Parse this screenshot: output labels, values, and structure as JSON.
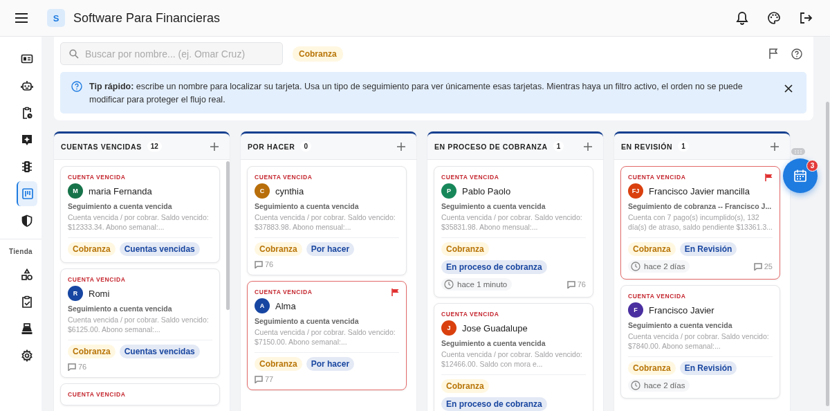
{
  "header": {
    "title": "Software Para Financieras",
    "logo_letter": "S"
  },
  "sidebar": {
    "items": [
      {
        "selected": false
      },
      {
        "selected": false
      },
      {
        "selected": false
      },
      {
        "selected": false
      },
      {
        "selected": false
      },
      {
        "selected": true
      },
      {
        "selected": false
      }
    ],
    "section_label": "Tienda",
    "store_items": [
      {
        "selected": false
      },
      {
        "selected": false
      },
      {
        "selected": false
      },
      {
        "selected": false
      }
    ]
  },
  "toolbar": {
    "search": {
      "placeholder": "Buscar por nombre... (ej. Omar Cruz)"
    },
    "filter_chip": "Cobranza"
  },
  "tip": {
    "text": "**Tip rápido:** escribe un nombre para localizar su tarjeta. Usa un tipo de seguimiento para ver únicamente esas tarjetas. Mientras haya un filtro activo, el orden no se puede modificar para proteger el flujo real."
  },
  "columns": [
    {
      "title": "CUENTAS VENCIDAS",
      "count": "12",
      "cards": [
        {
          "label": "CUENTA VENCIDA",
          "flagged": false,
          "initials": "M",
          "color": "#17734a",
          "name": "maria Fernanda",
          "subtitle": "Seguimiento a cuenta vencida",
          "description": "Cuenta vencida / por cobrar. Saldo vencido: $12333.34. Abono semanal:...",
          "tags": [
            {
              "kind": "type",
              "text": "Cobranza"
            },
            {
              "kind": "status",
              "text": "Cuentas vencidas"
            }
          ]
        },
        {
          "label": "CUENTA VENCIDA",
          "flagged": false,
          "initials": "R",
          "color": "#1746a2",
          "name": "Romi",
          "subtitle": "Seguimiento a cuenta vencida",
          "description": "Cuenta vencida / por cobrar. Saldo vencido: $6125.00. Abono semanal:...",
          "tags": [
            {
              "kind": "type",
              "text": "Cobranza"
            },
            {
              "kind": "status",
              "text": "Cuentas vencidas"
            }
          ],
          "comments": "76"
        },
        {
          "label": "CUENTA VENCIDA",
          "flagged": false
        }
      ]
    },
    {
      "title": "POR HACER",
      "count": "0",
      "cards": [
        {
          "label": "CUENTA VENCIDA",
          "flagged": false,
          "initials": "C",
          "color": "#b86e0a",
          "name": "cynthia",
          "subtitle": "Seguimiento a cuenta vencida",
          "description": "Cuenta vencida / por cobrar. Saldo vencido: $37883.98. Abono mensual:...",
          "tags": [
            {
              "kind": "type",
              "text": "Cobranza"
            },
            {
              "kind": "status",
              "text": "Por hacer"
            }
          ],
          "comments": "76"
        },
        {
          "label": "CUENTA VENCIDA",
          "flagged": true,
          "initials": "A",
          "color": "#1746a2",
          "name": "Alma",
          "subtitle": "Seguimiento a cuenta vencida",
          "description": "Cuenta vencida / por cobrar. Saldo vencido: $7150.00. Abono semanal:...",
          "tags": [
            {
              "kind": "type",
              "text": "Cobranza"
            },
            {
              "kind": "status",
              "text": "Por hacer"
            }
          ],
          "comments": "77"
        }
      ]
    },
    {
      "title": "EN PROCESO DE COBRANZA",
      "count": "1",
      "cards": [
        {
          "label": "CUENTA VENCIDA",
          "flagged": false,
          "initials": "P",
          "color": "#17875a",
          "name": "Pablo Paolo",
          "subtitle": "Seguimiento a cuenta vencida",
          "description": "Cuenta vencida / por cobrar. Saldo vencido: $35831.98. Abono mensual:...",
          "tags": [
            {
              "kind": "type",
              "text": "Cobranza"
            },
            {
              "kind": "status",
              "text": "En proceso de cobranza"
            }
          ],
          "time": "hace 1 minuto",
          "comments": "76"
        },
        {
          "label": "CUENTA VENCIDA",
          "flagged": false,
          "initials": "J",
          "color": "#d9400e",
          "name": "Jose Guadalupe",
          "subtitle": "Seguimiento a cuenta vencida",
          "description": "Cuenta vencida / por cobrar. Saldo vencido: $12466.00. Saldo con mora e...",
          "tags": [
            {
              "kind": "type",
              "text": "Cobranza"
            },
            {
              "kind": "status",
              "text": "En proceso de cobranza"
            }
          ]
        }
      ]
    },
    {
      "title": "EN REVISIÓN",
      "count": "1",
      "cards": [
        {
          "label": "CUENTA VENCIDA",
          "flagged": true,
          "initials": "FJ",
          "color": "#d9400e",
          "name": "Francisco Javier mancilla",
          "subtitle": "Seguimiento de cobranza -- Francisco J...",
          "description": "Cuenta con 7 pago(s) incumplido(s), 132 día(s) de atraso, saldo pendiente $13361.3...",
          "tags": [
            {
              "kind": "type",
              "text": "Cobranza"
            },
            {
              "kind": "status",
              "text": "En Revisión"
            }
          ],
          "time": "hace 2 días",
          "comments": "25"
        },
        {
          "label": "CUENTA VENCIDA",
          "flagged": false,
          "initials": "F",
          "color": "#4a2fa0",
          "name": "Francisco Javier",
          "subtitle": "Seguimiento a cuenta vencida",
          "description": "Cuenta vencida / por cobrar. Saldo vencido: $7840.00. Abono semanal:...",
          "tags": [
            {
              "kind": "type",
              "text": "Cobranza"
            },
            {
              "kind": "status",
              "text": "En Revisión"
            }
          ],
          "time": "hace 2 días"
        }
      ]
    }
  ],
  "calendar_fab": {
    "badge": "3"
  }
}
